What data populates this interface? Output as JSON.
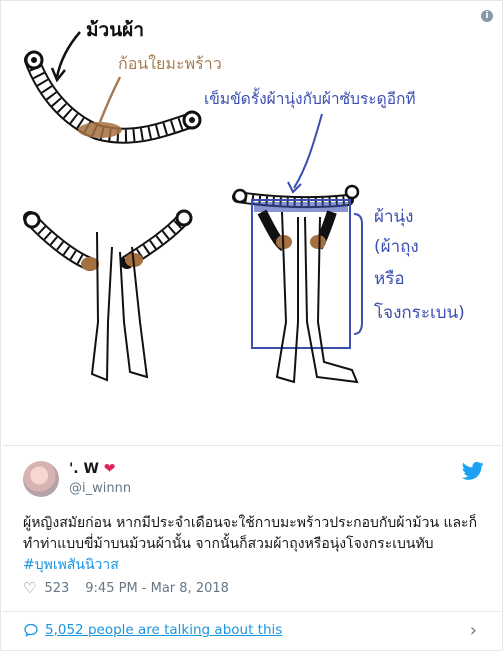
{
  "image": {
    "label_roll": "ม้วนผ้า",
    "label_coconut": "ก้อนใยมะพร้าว",
    "label_belt": "เข็มขัดรั้งผ้านุ่งกับผ้าซับระดูอีกที",
    "label_pants_lines": [
      "ผ้านุ่ง",
      "(ผ้าถุง",
      "หรือ",
      "โจงกระเบน)"
    ]
  },
  "tweet": {
    "display_name": "'. W",
    "handle": "@i_winnn",
    "text_main": "ผู้หญิงสมัยก่อน หากมีประจำเดือนจะใช้กาบมะพร้าวประกอบกับผ้าม้วน และก็ทำท่าแบบขี่ม้าบนม้วนผ้านั้น จากนั้นก็สวมผ้าถุงหรือนุ่งโจงกระเบนทับ",
    "hashtag": "#บุพเพสันนิวาส",
    "like_count": "523",
    "timestamp": "9:45 PM - Mar 8, 2018",
    "talking_text": "5,052 people are talking about this"
  },
  "colors": {
    "link": "#1b95e0",
    "heart": "#e0245e",
    "brown_label": "#a87c53",
    "blue_label": "#3b4fb0"
  }
}
